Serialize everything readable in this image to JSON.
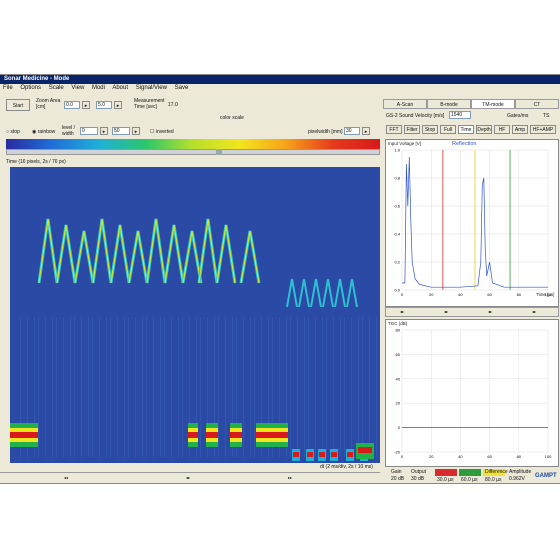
{
  "window": {
    "title": "Sonar Medicine - Mode"
  },
  "menu": [
    "File",
    "Options",
    "Scale",
    "View",
    "Modi",
    "About",
    "Signal/View",
    "Save"
  ],
  "toolbar": {
    "start_label": "Start",
    "zoom_label": "Zoom Area\n[cm]",
    "zoom_from": "0.0",
    "zoom_to": "5.0",
    "measurement_label": "Measurement\nTime [sec]",
    "measurement_value": "17.0",
    "color_scale_label": "color scale",
    "stop_label": "stop",
    "rainbow_label": "rainbow",
    "level_label": "level /\nwidth",
    "level_value": "0",
    "width_value": "50",
    "inverted_label": "inverted",
    "pixelwidth_label": "pixelwidth [mm]",
    "pixelwidth_value": "30"
  },
  "spectrogram": {
    "time_label": "Time (16 pixels, 2s / 76 px)",
    "footer_label": "dt (2 ms/div, 2s / 10 ms)"
  },
  "right_panel": {
    "tabs": [
      "A-Scan",
      "B-mode",
      "TM-mode",
      "CT"
    ],
    "active_tab": "TM-mode",
    "device_label": "GS-2",
    "sound_velocity_label": "Sound Velocity [m/s]",
    "sound_velocity_value": "1540",
    "gate_label": "Gates/ms",
    "gate_value": "TS",
    "subtabs": [
      "FFT",
      "Filter",
      "Stop",
      "Full",
      "Time",
      "Depth",
      "HF",
      "Amp",
      "HF+AMP"
    ],
    "graph1": {
      "ylabel": "Input Voltage [V]",
      "title": "Reflection",
      "xlabel": "Time [µs]",
      "yticks": [
        "1.0",
        "0.8",
        "0.6",
        "0.4",
        "0.2",
        "0.0"
      ],
      "xticks": [
        "0",
        "20",
        "40",
        "60",
        "80",
        "100"
      ]
    },
    "graph2": {
      "ylabel": "TGC (dB)",
      "yticks": [
        "80",
        "60",
        "40",
        "20",
        "0",
        "-20"
      ],
      "xticks": [
        "0",
        "20",
        "40",
        "60",
        "80",
        "100"
      ]
    },
    "legend": {
      "gain_label": "Gain",
      "gain_value": "20 dB",
      "output_label": "Output",
      "output_value": "30 dB",
      "box1": "30.0 µs",
      "box2": "60.0 µs",
      "box3": "80.0 µs",
      "diff_label": "Difference",
      "amp_label": "Amplitude",
      "amp_value": "0.962V",
      "brand": "GAMPT"
    }
  },
  "colors": {
    "spectro_bg": "#2a4aa5",
    "accent": "#0a246a"
  }
}
